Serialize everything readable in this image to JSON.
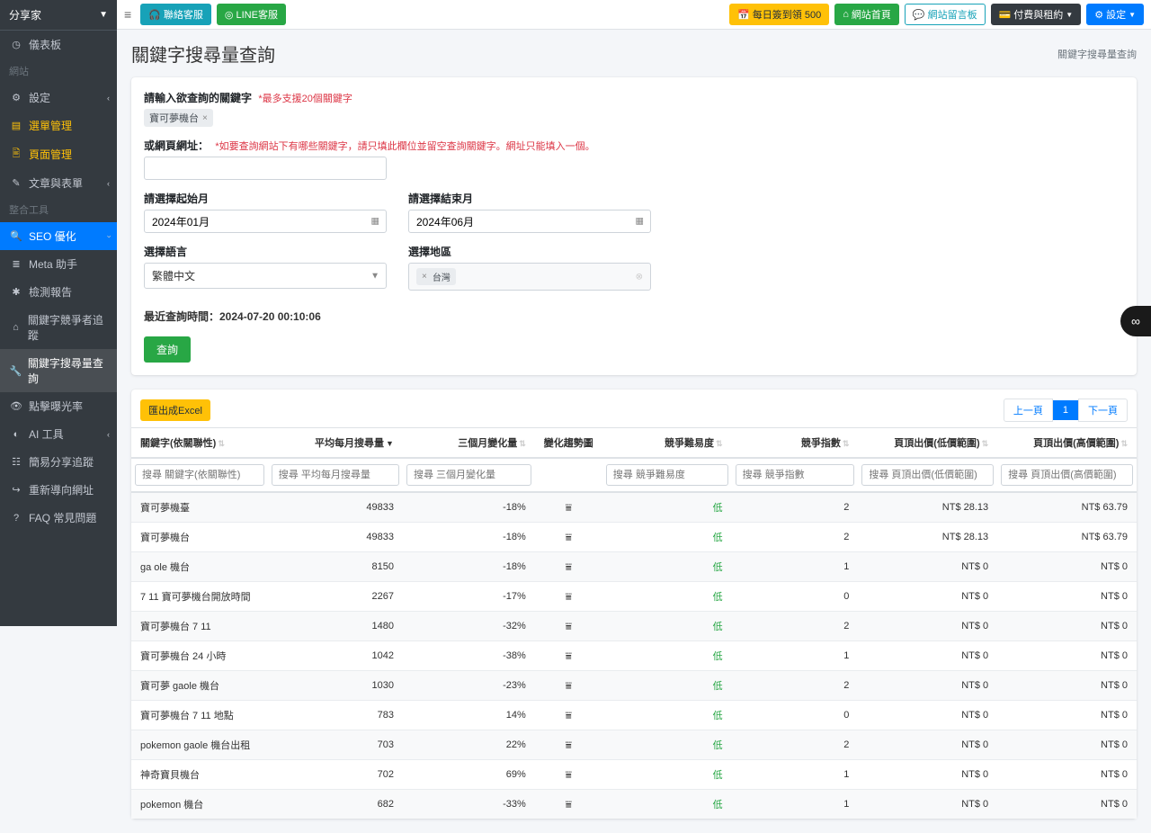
{
  "brand": "分享家",
  "sidebar": {
    "items": [
      {
        "icon": "◷",
        "label": "儀表板"
      },
      {
        "header": true,
        "label": "網站"
      },
      {
        "icon": "⚙",
        "label": "設定",
        "chev": true
      },
      {
        "icon": "▤",
        "label": "選單管理",
        "warn": true
      },
      {
        "icon": "🖹",
        "label": "頁面管理",
        "warn": true
      },
      {
        "icon": "✎",
        "label": "文章與表單",
        "chev": true
      },
      {
        "header": true,
        "label": "整合工具"
      },
      {
        "icon": "🔍",
        "label": "SEO 優化",
        "active": true,
        "chev_down": true
      },
      {
        "icon": "≣",
        "label": "Meta 助手",
        "sub": true
      },
      {
        "icon": "✱",
        "label": "檢測報告",
        "sub": true
      },
      {
        "icon": "⌂",
        "label": "關鍵字競爭者追蹤",
        "sub": true
      },
      {
        "icon": "🔧",
        "label": "關鍵字搜尋量查詢",
        "sub_active": true
      },
      {
        "icon": "👁",
        "label": "點擊曝光率",
        "sub": true
      },
      {
        "icon": "◐",
        "label": "AI 工具",
        "chev": true
      },
      {
        "icon": "☷",
        "label": "簡易分享追蹤"
      },
      {
        "icon": "↪",
        "label": "重新導向網址"
      },
      {
        "icon": "?",
        "label": "FAQ 常見問題"
      }
    ]
  },
  "topbar": {
    "contact": "聯絡客服",
    "line": "LINE客服",
    "quota": "每日簽到領 500",
    "home": "網站首頁",
    "msgboard": "網站留言板",
    "billing": "付費與租約",
    "settings": "設定"
  },
  "page": {
    "title": "關鍵字搜尋量查詢",
    "crumb": "關鍵字搜尋量查詢"
  },
  "form": {
    "kw_label": "請輸入欲查詢的關鍵字",
    "kw_hint": "*最多支援20個關鍵字",
    "kw_tag": "寶可夢機台",
    "url_label": "或網頁網址：",
    "url_hint": "*如要查詢網站下有哪些關鍵字，請只填此欄位並留空查詢關鍵字。網址只能填入一個。",
    "start_label": "請選擇起始月",
    "start_value": "2024年01月",
    "end_label": "請選擇結束月",
    "end_value": "2024年06月",
    "lang_label": "選擇語言",
    "lang_value": "繁體中文",
    "region_label": "選擇地區",
    "region_value": "台灣",
    "last_query": "最近查詢時間：2024-07-20 00:10:06",
    "search_btn": "查詢"
  },
  "table": {
    "export": "匯出成Excel",
    "prev": "上一頁",
    "page": "1",
    "next": "下一頁",
    "cols": [
      "關鍵字(依關聯性)",
      "平均每月搜尋量",
      "三個月變化量",
      "變化趨勢圖",
      "競爭難易度",
      "競爭指數",
      "頁頂出價(低價範圍)",
      "頁頂出價(高價範圍)"
    ],
    "ph": [
      "搜尋 關鍵字(依關聯性)",
      "搜尋 平均每月搜尋量",
      "搜尋 三個月變化量",
      "",
      "搜尋 競爭難易度",
      "搜尋 競爭指數",
      "搜尋 頁頂出價(低價範圍)",
      "搜尋 頁頂出價(高價範圍)"
    ],
    "rows": [
      {
        "kw": "寶可夢機臺",
        "avg": "49833",
        "chg": "-18%",
        "diff": "低",
        "idx": "2",
        "low": "NT$ 28.13",
        "high": "NT$ 63.79"
      },
      {
        "kw": "寶可夢機台",
        "avg": "49833",
        "chg": "-18%",
        "diff": "低",
        "idx": "2",
        "low": "NT$ 28.13",
        "high": "NT$ 63.79"
      },
      {
        "kw": "ga ole 機台",
        "avg": "8150",
        "chg": "-18%",
        "diff": "低",
        "idx": "1",
        "low": "NT$ 0",
        "high": "NT$ 0"
      },
      {
        "kw": "7 11 寶可夢機台開放時間",
        "avg": "2267",
        "chg": "-17%",
        "diff": "低",
        "idx": "0",
        "low": "NT$ 0",
        "high": "NT$ 0"
      },
      {
        "kw": "寶可夢機台 7 11",
        "avg": "1480",
        "chg": "-32%",
        "diff": "低",
        "idx": "2",
        "low": "NT$ 0",
        "high": "NT$ 0"
      },
      {
        "kw": "寶可夢機台 24 小時",
        "avg": "1042",
        "chg": "-38%",
        "diff": "低",
        "idx": "1",
        "low": "NT$ 0",
        "high": "NT$ 0"
      },
      {
        "kw": "寶可夢 gaole 機台",
        "avg": "1030",
        "chg": "-23%",
        "diff": "低",
        "idx": "2",
        "low": "NT$ 0",
        "high": "NT$ 0"
      },
      {
        "kw": "寶可夢機台 7 11 地點",
        "avg": "783",
        "chg": "14%",
        "diff": "低",
        "idx": "0",
        "low": "NT$ 0",
        "high": "NT$ 0"
      },
      {
        "kw": "pokemon gaole 機台出租",
        "avg": "703",
        "chg": "22%",
        "diff": "低",
        "idx": "2",
        "low": "NT$ 0",
        "high": "NT$ 0"
      },
      {
        "kw": "神奇寶貝機台",
        "avg": "702",
        "chg": "69%",
        "diff": "低",
        "idx": "1",
        "low": "NT$ 0",
        "high": "NT$ 0"
      },
      {
        "kw": "pokemon 機台",
        "avg": "682",
        "chg": "-33%",
        "diff": "低",
        "idx": "1",
        "low": "NT$ 0",
        "high": "NT$ 0"
      }
    ]
  }
}
